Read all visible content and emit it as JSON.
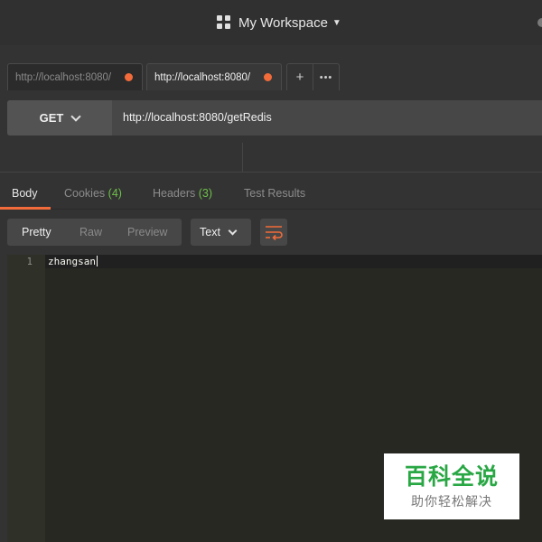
{
  "header": {
    "workspace_label": "My Workspace"
  },
  "tabs": [
    {
      "label": "http://localhost:8080/",
      "active": false,
      "unsaved": true
    },
    {
      "label": "http://localhost:8080/",
      "active": true,
      "unsaved": true
    }
  ],
  "tab_actions": {
    "add": "+",
    "more": "•••"
  },
  "request": {
    "method": "GET",
    "url": "http://localhost:8080/getRedis"
  },
  "response_tabs": {
    "body": "Body",
    "cookies": "Cookies",
    "cookies_count": "(4)",
    "headers": "Headers",
    "headers_count": "(3)",
    "test_results": "Test Results"
  },
  "view_modes": {
    "pretty": "Pretty",
    "raw": "Raw",
    "preview": "Preview",
    "selected": "Pretty"
  },
  "format": {
    "selected": "Text"
  },
  "editor": {
    "lines": [
      {
        "number": "1",
        "text": "zhangsan"
      }
    ]
  },
  "watermark": {
    "title": "百科全说",
    "subtitle": "助你轻松解决"
  },
  "colors": {
    "accent": "#f26b3a",
    "count_green": "#6ec14a",
    "editor_bg": "#272822",
    "watermark_green": "#29a744"
  }
}
